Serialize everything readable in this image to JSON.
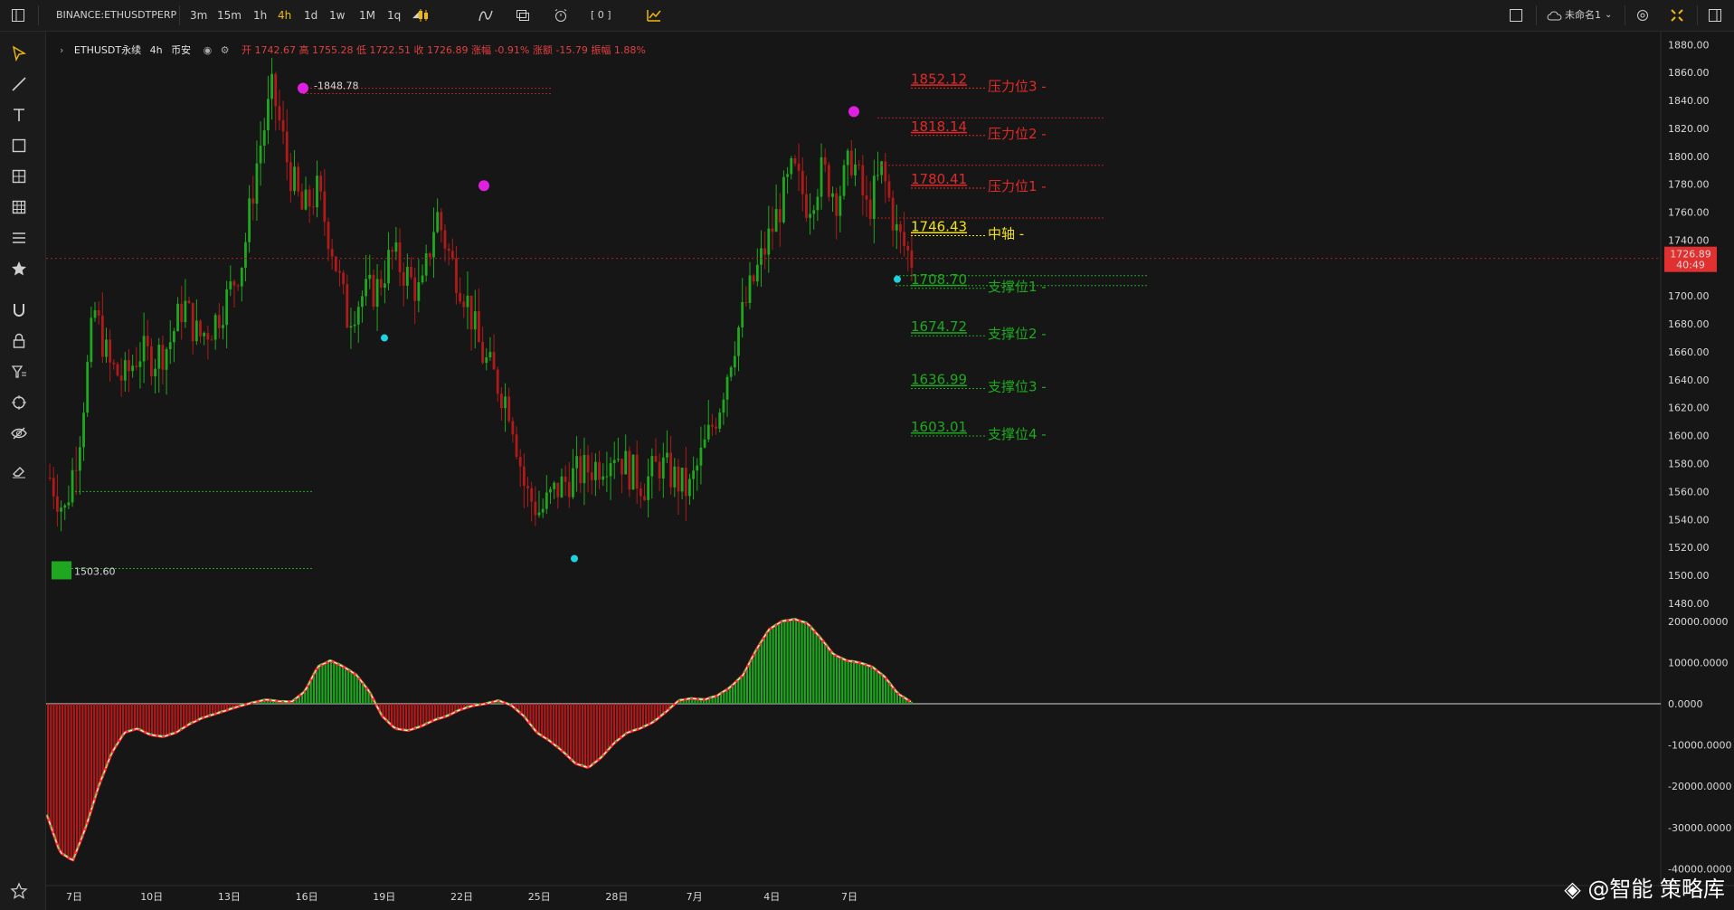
{
  "topbar": {
    "symbol": "BINANCE:ETHUSDTPERP",
    "intervals": [
      "3m",
      "15m",
      "1h",
      "4h",
      "1d",
      "1w",
      "1M",
      "1q"
    ],
    "active_interval": "4h",
    "bracket": "[ 0 ]",
    "layout_name": "未命名1"
  },
  "legend": {
    "name": "ETHUSDT永续",
    "interval": "4h",
    "exchange": "币安",
    "ohlc_text": "开 1742.67  高 1755.28  低 1722.51  收 1726.89  涨幅 -0.91%  涨额 -15.79  振幅 1.88%"
  },
  "price_label": {
    "price": "1726.89",
    "countdown": "40:49"
  },
  "watermark": "@智能 策略库",
  "colors": {
    "up": "#1fa81f",
    "down": "#b01a1a",
    "accent": "#f0b90b",
    "pivot_high": "#e020e0",
    "pivot_low": "#20d0e0"
  },
  "chart_data": [
    {
      "type": "candlestick",
      "symbol": "ETHUSDT",
      "interval": "4h",
      "y_ticks": [
        1880,
        1860,
        1840,
        1820,
        1800,
        1780,
        1760,
        1740,
        1720,
        1700,
        1680,
        1660,
        1640,
        1620,
        1600,
        1580,
        1560,
        1540,
        1520,
        1500,
        1480
      ],
      "y_tick_labels": [
        "1880.00",
        "1860.00",
        "1840.00",
        "1820.00",
        "1800.00",
        "1780.00",
        "1760.00",
        "1740.00",
        "1720.00",
        "1700.00",
        "1680.00",
        "1660.00",
        "1640.00",
        "1620.00",
        "1600.00",
        "1580.00",
        "1560.00",
        "1540.00",
        "1520.00",
        "1500.00",
        "1480.00"
      ],
      "ylim": [
        1478,
        1886
      ],
      "x_tick_labels": [
        "7日",
        "10日",
        "13日",
        "16日",
        "19日",
        "22日",
        "25日",
        "28日",
        "7月",
        "4日",
        "7日"
      ],
      "trend_path": [
        1570,
        1545,
        1600,
        1690,
        1650,
        1640,
        1660,
        1655,
        1665,
        1695,
        1670,
        1680,
        1700,
        1728,
        1800,
        1848,
        1795,
        1760,
        1775,
        1735,
        1685,
        1700,
        1705,
        1730,
        1715,
        1700,
        1760,
        1725,
        1700,
        1660,
        1640,
        1620,
        1560,
        1545,
        1560,
        1570,
        1575,
        1580,
        1590,
        1575,
        1565,
        1580,
        1570,
        1560,
        1590,
        1620,
        1665,
        1700,
        1730,
        1760,
        1790,
        1765,
        1790,
        1770,
        1800,
        1760,
        1790,
        1745,
        1726
      ],
      "marked_high": 1848.78,
      "marked_low": 1503.6,
      "current_price": 1726.89,
      "levels": [
        {
          "value": "1852.12",
          "name": "压力位3",
          "color": "#e02a2a"
        },
        {
          "value": "1818.14",
          "name": "压力位2",
          "color": "#e02a2a"
        },
        {
          "value": "1780.41",
          "name": "压力位1",
          "color": "#e02a2a"
        },
        {
          "value": "1746.43",
          "name": "中轴",
          "color": "#f0e020"
        },
        {
          "value": "1708.70",
          "name": "支撑位1",
          "color": "#1fa81f"
        },
        {
          "value": "1674.72",
          "name": "支撑位2",
          "color": "#1fa81f"
        },
        {
          "value": "1636.99",
          "name": "支撑位3",
          "color": "#1fa81f"
        },
        {
          "value": "1603.01",
          "name": "支撑位4",
          "color": "#1fa81f"
        }
      ],
      "pivots": [
        {
          "kind": "high",
          "value": 1848.78
        },
        {
          "kind": "low",
          "value": 1670
        },
        {
          "kind": "high",
          "value": 1779
        },
        {
          "kind": "low",
          "value": 1512
        },
        {
          "kind": "high",
          "value": 1832
        },
        {
          "kind": "low",
          "value": 1712
        }
      ]
    },
    {
      "type": "histogram",
      "y_ticks": [
        20000,
        10000,
        0,
        -10000,
        -20000,
        -30000,
        -40000
      ],
      "y_tick_labels": [
        "20000.0000",
        "10000.0000",
        "0.0000",
        "-10000.0000",
        "-20000.0000",
        "-30000.0000",
        "-40000.0000"
      ],
      "ylim": [
        -41000,
        21500
      ],
      "histogram_path": [
        -27000,
        -36000,
        -38000,
        -30000,
        -20000,
        -12000,
        -7000,
        -6000,
        -7500,
        -8000,
        -7000,
        -5000,
        -3500,
        -2500,
        -1500,
        -500,
        300,
        1000,
        600,
        500,
        3000,
        9000,
        10500,
        9000,
        7000,
        3000,
        -3000,
        -6000,
        -6500,
        -5500,
        -4000,
        -3000,
        -1500,
        -500,
        0,
        800,
        -300,
        -3000,
        -7000,
        -9000,
        -11500,
        -14500,
        -15500,
        -13000,
        -9500,
        -7000,
        -6000,
        -4500,
        -2000,
        800,
        1300,
        1000,
        2000,
        4000,
        7000,
        13000,
        18000,
        20000,
        20500,
        19500,
        16000,
        12000,
        10500,
        10000,
        9000,
        6500,
        2500,
        500
      ]
    }
  ]
}
